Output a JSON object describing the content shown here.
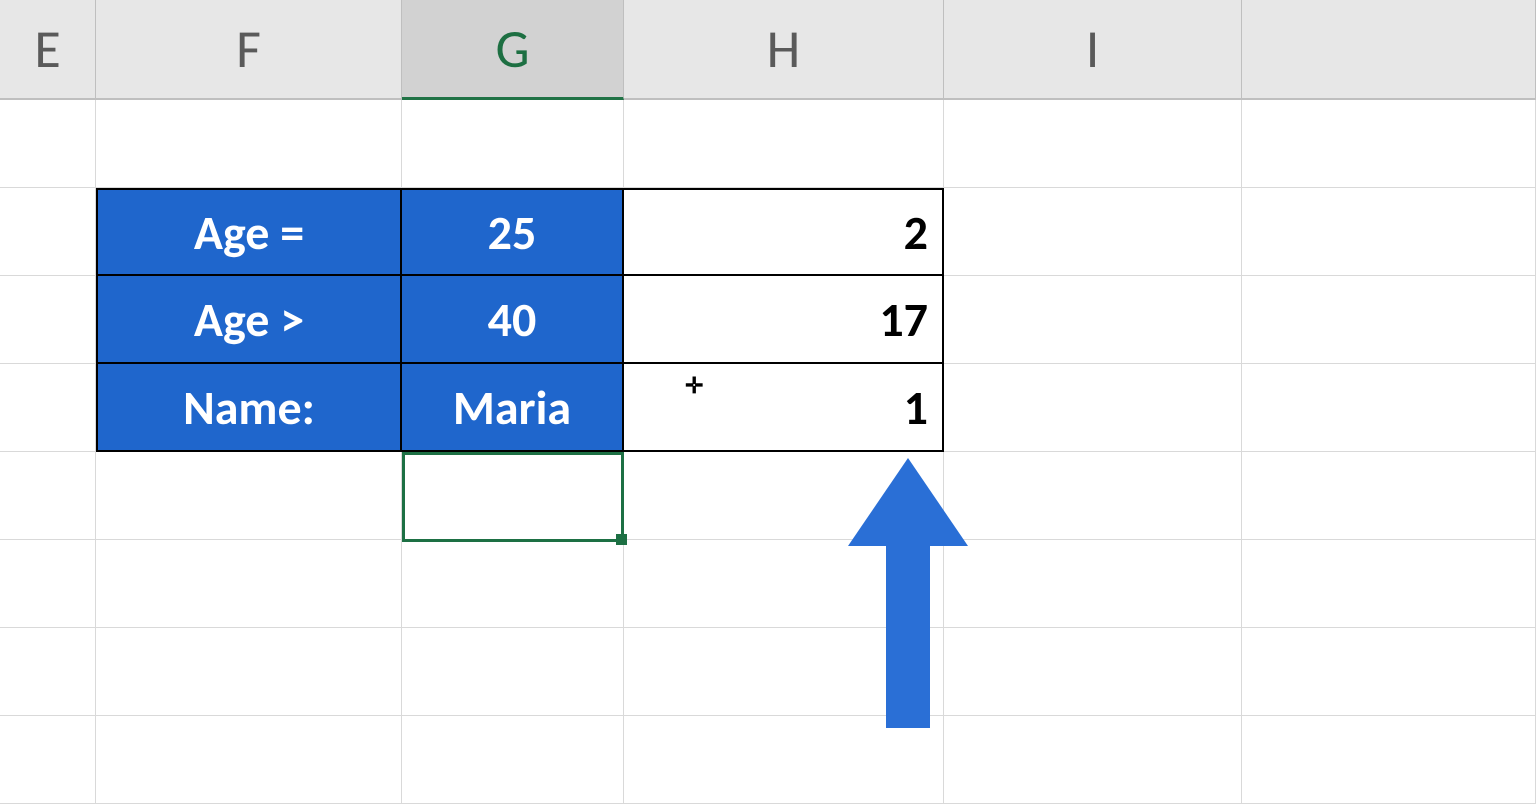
{
  "columns": {
    "E": "E",
    "F": "F",
    "G": "G",
    "H": "H",
    "I": "I"
  },
  "selected_column": "G",
  "table": {
    "rows": [
      {
        "label": "Age =",
        "value": "25",
        "result": "2"
      },
      {
        "label": "Age >",
        "value": "40",
        "result": "17"
      },
      {
        "label": "Name:",
        "value": "Maria",
        "result": "1"
      }
    ]
  },
  "colors": {
    "fill_blue": "#1f66cc",
    "arrow_blue": "#2a6fd6",
    "header_bg": "#e7e7e7",
    "selection_green": "#1d7044"
  },
  "active_cell": "G5",
  "annotation": {
    "arrow_points_to": "H4"
  }
}
